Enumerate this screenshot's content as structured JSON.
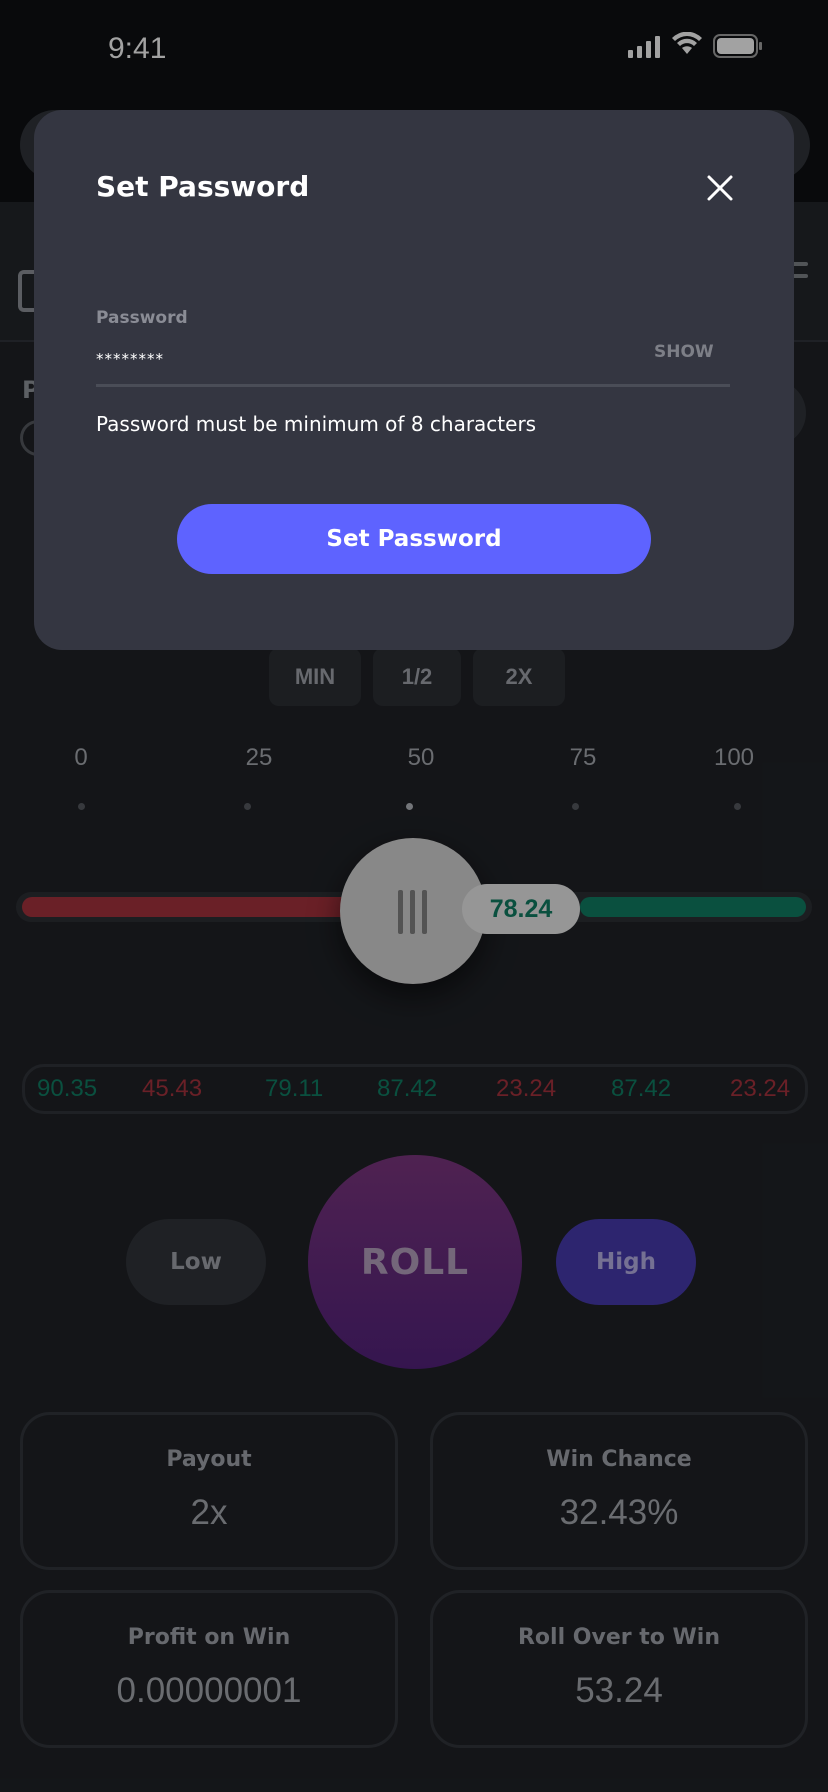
{
  "status_bar": {
    "time": "9:41"
  },
  "background": {
    "partial_label": "P",
    "bet_buttons": [
      "MIN",
      "1/2",
      "2X"
    ],
    "scale_labels": [
      "0",
      "25",
      "50",
      "75",
      "100"
    ],
    "slider": {
      "value_label": "78.24",
      "value": 78.24
    },
    "history": [
      {
        "value": "90.35",
        "color": "#0e6b55"
      },
      {
        "value": "45.43",
        "color": "#8e2b34"
      },
      {
        "value": "79.11",
        "color": "#0e6b55"
      },
      {
        "value": "87.42",
        "color": "#0e6b55"
      },
      {
        "value": "23.24",
        "color": "#8e2b34"
      },
      {
        "value": "87.42",
        "color": "#0e6b55"
      },
      {
        "value": "23.24",
        "color": "#8e2b34"
      }
    ],
    "roll": {
      "low_label": "Low",
      "roll_label": "ROLL",
      "high_label": "High"
    },
    "stats": [
      {
        "label": "Payout",
        "value": "2x"
      },
      {
        "label": "Win Chance",
        "value": "32.43%"
      },
      {
        "label": "Profit on Win",
        "value": "0.00000001"
      },
      {
        "label": "Roll Over to Win",
        "value": "53.24"
      }
    ]
  },
  "modal": {
    "title": "Set Password",
    "password_label": "Password",
    "password_value": "********",
    "show_label": "SHOW",
    "hint": "Password must be minimum of 8 characters",
    "submit_label": "Set Password"
  },
  "colors": {
    "accent": "#5e63ff",
    "win": "#0e6b55",
    "loss": "#8e2b34"
  }
}
